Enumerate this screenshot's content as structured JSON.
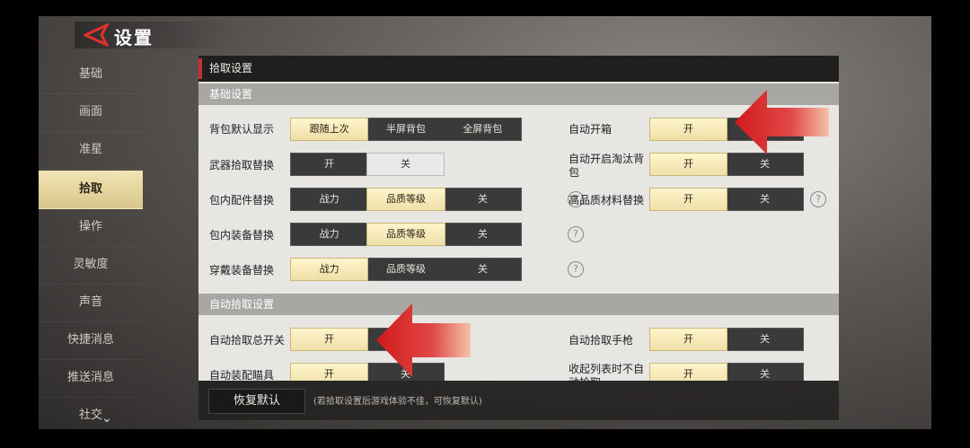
{
  "header": {
    "title": "设置"
  },
  "sidebar": {
    "items": [
      {
        "label": "基础"
      },
      {
        "label": "画面"
      },
      {
        "label": "准星"
      },
      {
        "label": "拾取"
      },
      {
        "label": "操作"
      },
      {
        "label": "灵敏度"
      },
      {
        "label": "声音"
      },
      {
        "label": "快捷消息"
      },
      {
        "label": "推送消息"
      },
      {
        "label": "社交"
      }
    ],
    "active": "拾取"
  },
  "panel": {
    "title": "拾取设置",
    "section_basic": "基础设置",
    "section_auto": "自动拾取设置",
    "rows": {
      "bag_display": {
        "label": "背包默认显示",
        "options": [
          "跟随上次",
          "半屏背包",
          "全屏背包"
        ],
        "selected": "跟随上次"
      },
      "weapon_replace": {
        "label": "武器拾取替换",
        "options": [
          "开",
          "关"
        ],
        "selected": "关"
      },
      "attachment_replace": {
        "label": "包内配件替换",
        "options": [
          "战力",
          "品质等级",
          "关"
        ],
        "selected": "品质等级"
      },
      "equip_replace": {
        "label": "包内装备替换",
        "options": [
          "战力",
          "品质等级",
          "关"
        ],
        "selected": "品质等级"
      },
      "wear_replace": {
        "label": "穿戴装备替换",
        "options": [
          "战力",
          "品质等级",
          "关"
        ],
        "selected": "战力"
      },
      "auto_open_box": {
        "label": "自动开箱",
        "options": [
          "开",
          "关"
        ],
        "selected": "开"
      },
      "auto_open_bag": {
        "label": "自动开启淘汰背包",
        "options": [
          "开",
          "关"
        ],
        "selected": "开"
      },
      "hq_material": {
        "label": "高品质材料替换",
        "options": [
          "开",
          "关"
        ],
        "selected": "开"
      },
      "auto_pickup_master": {
        "label": "自动拾取总开关",
        "options": [
          "开",
          "关"
        ],
        "selected": "开"
      },
      "auto_pickup_pistol": {
        "label": "自动拾取手枪",
        "options": [
          "开",
          "关"
        ],
        "selected": "开"
      },
      "auto_equip_scope": {
        "label": "自动装配瞄具",
        "options": [
          "开",
          "关"
        ],
        "selected": "开"
      },
      "collapse_list": {
        "label": "收起列表时不自动拾取",
        "options": [
          "开",
          "关"
        ],
        "selected": "开"
      }
    },
    "help_glyph": "?"
  },
  "footer": {
    "reset_label": "恢复默认",
    "note": "(若拾取设置后游戏体验不佳，可恢复默认)"
  },
  "colors": {
    "accent_red": "#c73030",
    "selected_gold": "#efe0a8"
  }
}
